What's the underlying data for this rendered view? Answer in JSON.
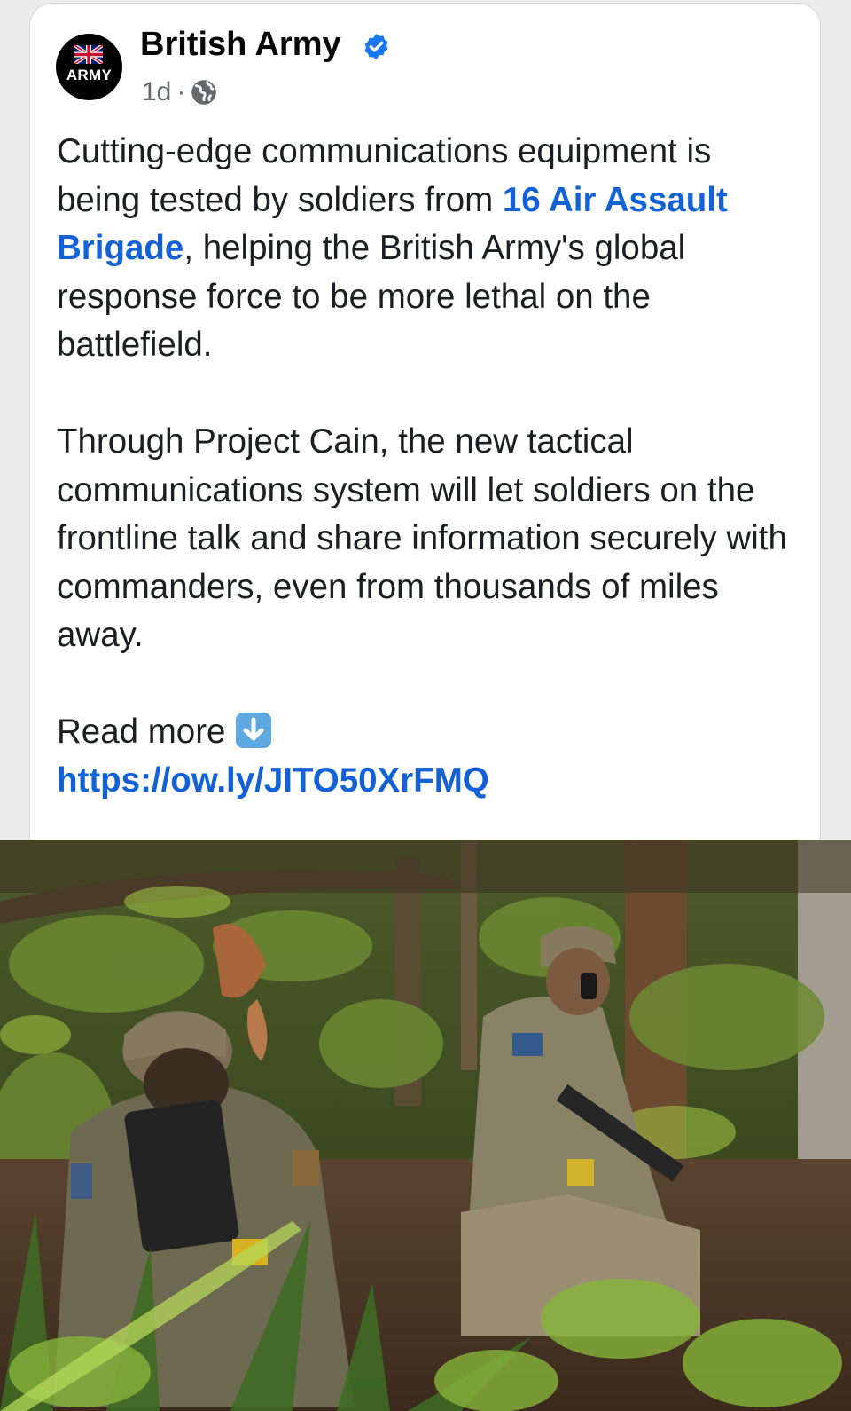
{
  "post": {
    "author": "British Army",
    "avatar_text": "ARMY",
    "time": "1d",
    "separator": "·",
    "audience_icon": "globe-icon",
    "verified_icon": "verified-badge-icon",
    "paragraph1": {
      "part1": "Cutting-edge communications equipment is being tested by soldiers from ",
      "mention": "16 Air Assault Brigade",
      "part2": ", helping the British Army's global response force to be more lethal on the battlefield."
    },
    "paragraph2": "Through Project Cain, the new tactical communications system will let soldiers on the frontline talk and share information securely with commanders, even from thousands of miles away.",
    "read_more": "Read more",
    "read_more_icon": "down-arrow-icon",
    "link": "https://ow.ly/JITO50XrFMQ"
  },
  "colors": {
    "link": "#1361d6",
    "verified": "#1877f2",
    "muted": "#65676b"
  }
}
